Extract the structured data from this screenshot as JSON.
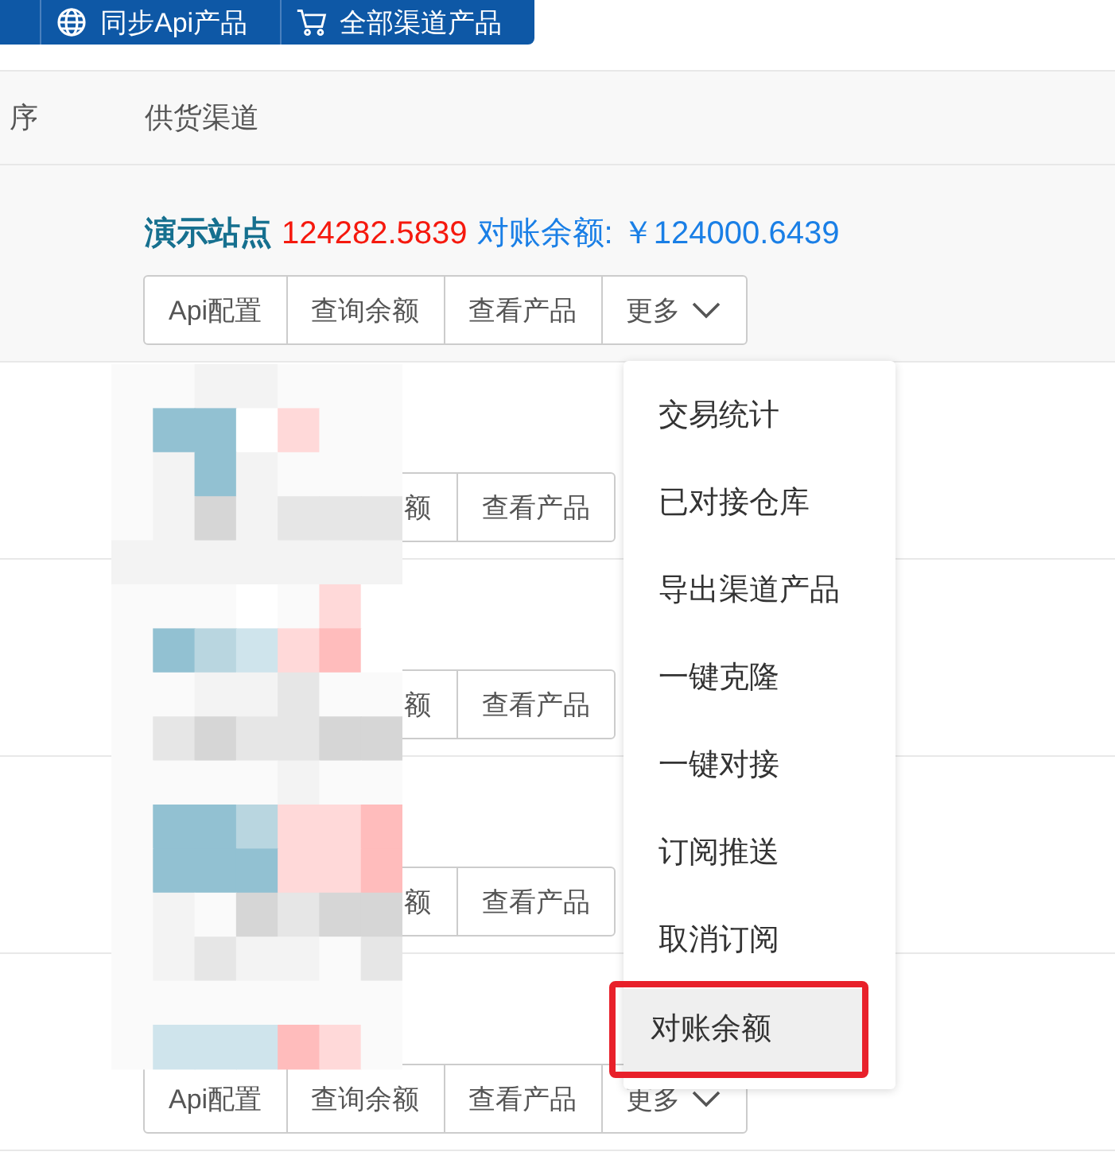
{
  "toolbar": [
    {
      "kind": "blank"
    },
    {
      "kind": "globe",
      "label": "同步Api产品"
    },
    {
      "kind": "cart",
      "label": "全部渠道产品"
    }
  ],
  "table": {
    "columns": [
      "序",
      "供货渠道"
    ],
    "rows": [
      {
        "kind": "full",
        "name": "演示站点",
        "balance": "124282.5839",
        "reconcile_label": "对账余额:",
        "reconcile_value": "￥124000.6439",
        "buttons": [
          {
            "label": "Api配置",
            "caret": false
          },
          {
            "label": "查询余额",
            "caret": false
          },
          {
            "label": "查看产品",
            "caret": false
          },
          {
            "label": "更多",
            "caret": true
          }
        ]
      },
      {
        "kind": "covered",
        "buttons": [
          {
            "label": "额",
            "caret": false
          },
          {
            "label": "查看产品",
            "caret": false
          }
        ]
      },
      {
        "kind": "covered",
        "buttons": [
          {
            "label": "额",
            "caret": false
          },
          {
            "label": "查看产品",
            "caret": false
          }
        ]
      },
      {
        "kind": "covered",
        "buttons": [
          {
            "label": "额",
            "caret": false
          },
          {
            "label": "查看产品",
            "caret": false
          }
        ]
      },
      {
        "kind": "buttons",
        "buttons": [
          {
            "label": "Api配置",
            "caret": false
          },
          {
            "label": "查询余额",
            "caret": false
          },
          {
            "label": "查看产品",
            "caret": false
          },
          {
            "label": "更多",
            "caret": true
          }
        ]
      }
    ]
  },
  "dropdown": [
    {
      "label": "交易统计",
      "selected": false,
      "marked": false
    },
    {
      "label": "已对接仓库",
      "selected": false,
      "marked": false
    },
    {
      "label": "导出渠道产品",
      "selected": false,
      "marked": false
    },
    {
      "label": "一键克隆",
      "selected": false,
      "marked": false
    },
    {
      "label": "一键对接",
      "selected": false,
      "marked": false
    },
    {
      "label": "订阅推送",
      "selected": false,
      "marked": false
    },
    {
      "label": "取消订阅",
      "selected": false,
      "marked": false
    },
    {
      "label": "对账余额",
      "selected": true,
      "marked": true
    }
  ]
}
